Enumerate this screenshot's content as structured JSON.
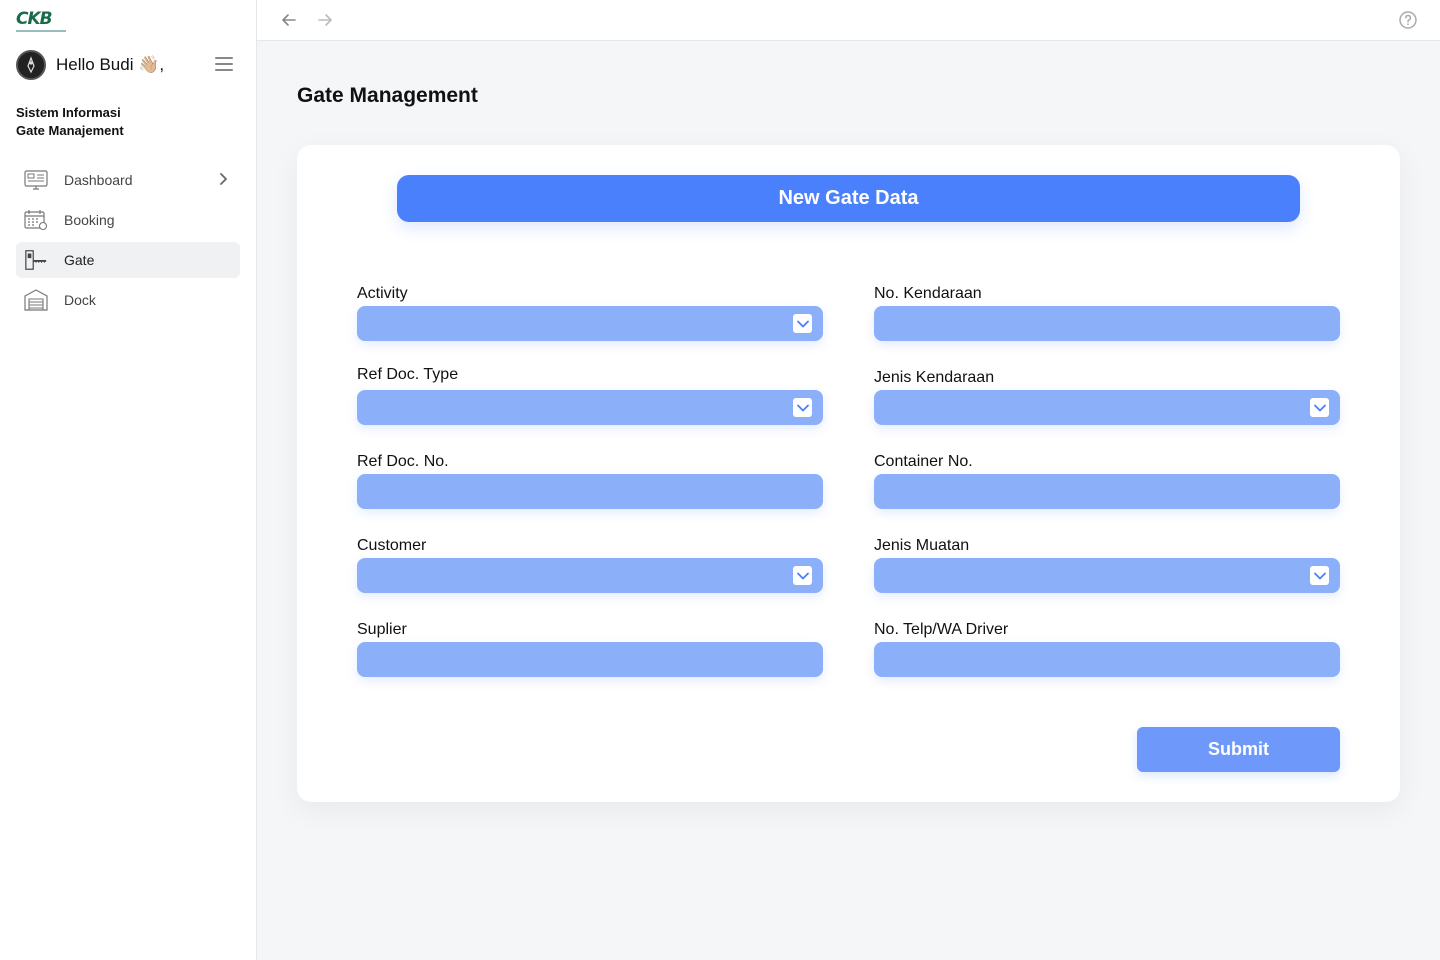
{
  "brand": {
    "logo_text": "CKB"
  },
  "user": {
    "greeting": "Hello Budi 👋🏼,"
  },
  "sidebar": {
    "system_title_line1": "Sistem Informasi",
    "system_title_line2": "Gate Manajement",
    "items": [
      {
        "label": "Dashboard",
        "icon": "dashboard-icon",
        "active": false,
        "has_chevron": true
      },
      {
        "label": "Booking",
        "icon": "calendar-icon",
        "active": false
      },
      {
        "label": "Gate",
        "icon": "gate-icon",
        "active": true
      },
      {
        "label": "Dock",
        "icon": "warehouse-icon",
        "active": false
      }
    ]
  },
  "topbar": {
    "back_icon": "arrow-left-icon",
    "forward_icon": "arrow-right-icon",
    "help_icon": "help-circle-icon"
  },
  "page": {
    "title": "Gate Management"
  },
  "form": {
    "header_button": "New Gate Data",
    "left_fields": [
      {
        "label": "Activity",
        "type": "select",
        "value": ""
      },
      {
        "label": "Ref Doc. Type",
        "type": "select",
        "value": ""
      },
      {
        "label": "Ref Doc. No.",
        "type": "text",
        "value": ""
      },
      {
        "label": "Customer",
        "type": "select",
        "value": ""
      },
      {
        "label": "Suplier",
        "type": "text",
        "value": ""
      }
    ],
    "right_fields": [
      {
        "label": "No. Kendaraan",
        "type": "text",
        "value": ""
      },
      {
        "label": "Jenis Kendaraan",
        "type": "select",
        "value": ""
      },
      {
        "label": "Container No.",
        "type": "text",
        "value": ""
      },
      {
        "label": "Jenis Muatan",
        "type": "select",
        "value": ""
      },
      {
        "label": "No. Telp/WA Driver",
        "type": "text",
        "value": ""
      }
    ],
    "submit_label": "Submit"
  },
  "colors": {
    "primary": "#4a80fb",
    "field_bg": "#8caff9",
    "submit_bg": "#6f98fb",
    "brand_green": "#1a6b4a"
  }
}
